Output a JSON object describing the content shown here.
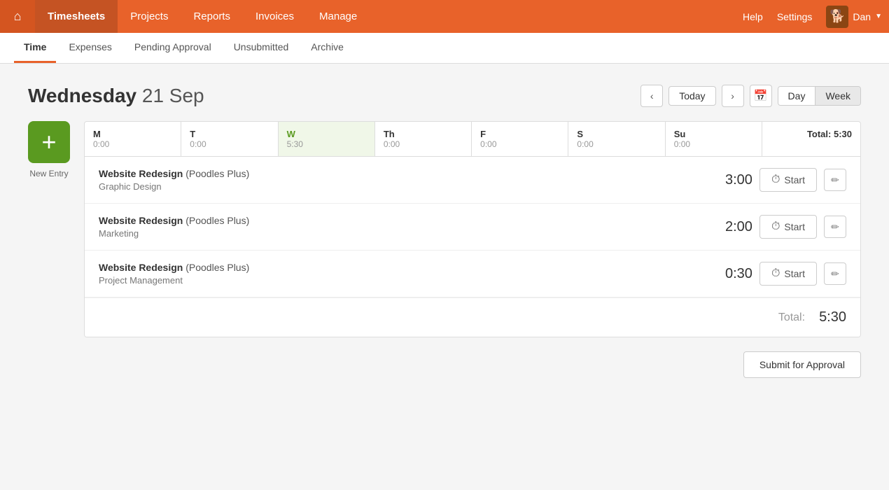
{
  "nav": {
    "home_icon": "🏠",
    "items": [
      {
        "label": "Timesheets",
        "active": true
      },
      {
        "label": "Projects",
        "active": false
      },
      {
        "label": "Reports",
        "active": false
      },
      {
        "label": "Invoices",
        "active": false
      },
      {
        "label": "Manage",
        "active": false
      }
    ],
    "help": "Help",
    "settings": "Settings",
    "user": {
      "name": "Dan",
      "avatar_icon": "👤"
    }
  },
  "sub_nav": {
    "tabs": [
      {
        "label": "Time",
        "active": true
      },
      {
        "label": "Expenses",
        "active": false
      },
      {
        "label": "Pending Approval",
        "active": false
      },
      {
        "label": "Unsubmitted",
        "active": false
      },
      {
        "label": "Archive",
        "active": false
      }
    ]
  },
  "date_header": {
    "day_name": "Wednesday",
    "day_date": "21 Sep",
    "today_btn": "Today",
    "day_btn": "Day",
    "week_btn": "Week"
  },
  "week_days": [
    {
      "short": "M",
      "hours": "0:00",
      "today": false
    },
    {
      "short": "T",
      "hours": "0:00",
      "today": false
    },
    {
      "short": "W",
      "hours": "5:30",
      "today": true
    },
    {
      "short": "Th",
      "hours": "0:00",
      "today": false
    },
    {
      "short": "F",
      "hours": "0:00",
      "today": false
    },
    {
      "short": "S",
      "hours": "0:00",
      "today": false
    },
    {
      "short": "Su",
      "hours": "0:00",
      "today": false
    }
  ],
  "week_total": "Total: 5:30",
  "entries": [
    {
      "project": "Website Redesign",
      "client": "(Poodles Plus)",
      "task": "Graphic Design",
      "time": "3:00"
    },
    {
      "project": "Website Redesign",
      "client": "(Poodles Plus)",
      "task": "Marketing",
      "time": "2:00"
    },
    {
      "project": "Website Redesign",
      "client": "(Poodles Plus)",
      "task": "Project Management",
      "time": "0:30"
    }
  ],
  "total_label": "Total:",
  "total_value": "5:30",
  "new_entry_label": "New Entry",
  "start_label": "Start",
  "submit_label": "Submit for Approval"
}
